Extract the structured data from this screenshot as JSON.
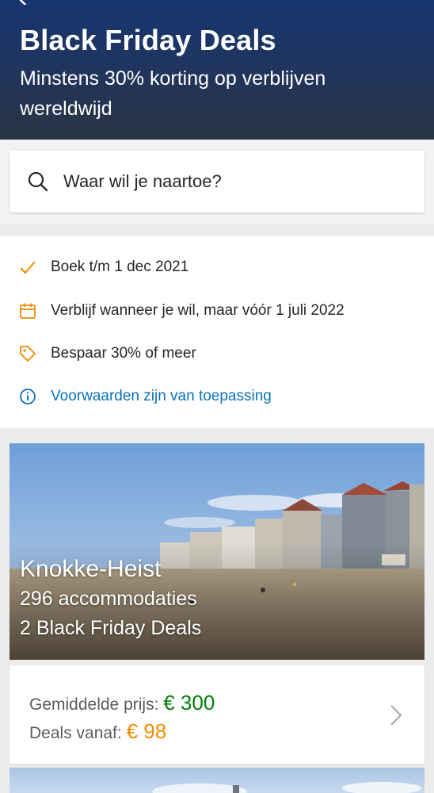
{
  "header": {
    "title": "Black Friday Deals",
    "subtitle": "Minstens 30% korting op verblijven wereldwijd"
  },
  "search": {
    "placeholder": "Waar wil je naartoe?"
  },
  "info": {
    "items": [
      {
        "icon": "checkmark-icon",
        "text": "Boek t/m 1 dec 2021"
      },
      {
        "icon": "calendar-icon",
        "text": "Verblijf wanneer je wil, maar vóór 1 juli 2022"
      },
      {
        "icon": "tag-icon",
        "text": "Bespaar 30% of meer"
      },
      {
        "icon": "info-icon",
        "text": "Voorwaarden zijn van toepassing"
      }
    ]
  },
  "card": {
    "city": "Knokke-Heist",
    "accommodations": "296 accommodaties",
    "deals": "2 Black Friday Deals",
    "avg_price_label": "Gemiddelde prijs:",
    "avg_price_value": "€ 300",
    "deals_from_label": "Deals vanaf:",
    "deals_from_value": "€ 98"
  },
  "colors": {
    "header_top": "#16356f",
    "accent_orange": "#ef8b00",
    "link_blue": "#0a72b9",
    "price_green": "#008009"
  }
}
